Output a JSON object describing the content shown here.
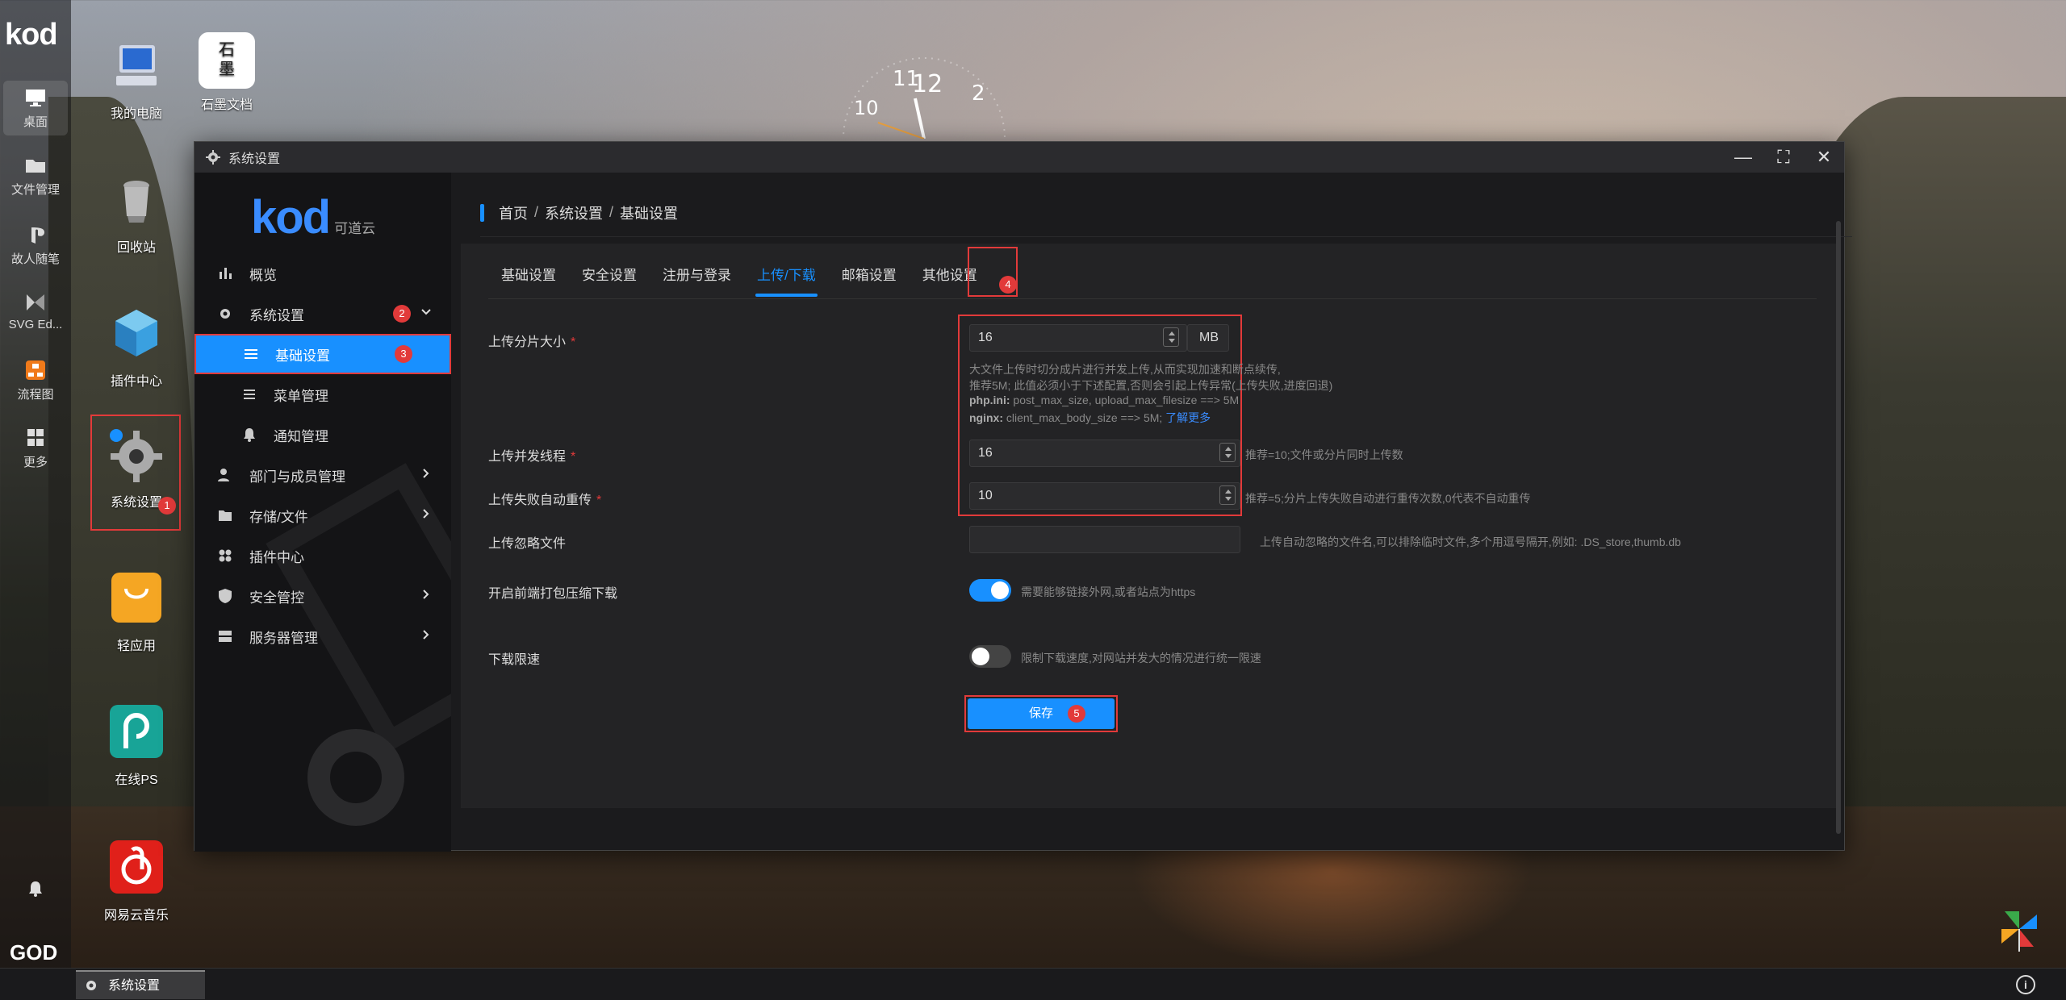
{
  "dock": {
    "logo": "kod",
    "items": [
      {
        "label": "桌面",
        "icon": "monitor-icon"
      },
      {
        "label": "文件管理",
        "icon": "folder-icon"
      },
      {
        "label": "故人随笔",
        "icon": "playstation-icon"
      },
      {
        "label": "SVG Ed...",
        "icon": "svg-editor-icon"
      },
      {
        "label": "流程图",
        "icon": "flowchart-icon"
      },
      {
        "label": "更多",
        "icon": "grid-icon"
      }
    ],
    "bottom_logo": "GOD"
  },
  "desktop": {
    "icons": [
      {
        "label": "我的电脑"
      },
      {
        "label": "石墨文档",
        "glyph": "石\n墨"
      },
      {
        "label": "回收站"
      },
      {
        "label": "插件中心"
      },
      {
        "label": "系统设置"
      },
      {
        "label": "轻应用"
      },
      {
        "label": "在线PS"
      },
      {
        "label": "网易云音乐"
      }
    ]
  },
  "badges": {
    "b1": "1",
    "b2": "2",
    "b3": "3",
    "b4": "4",
    "b5": "5"
  },
  "window": {
    "title": "系统设置",
    "controls": {
      "minimize": "—",
      "maximize": "⛶",
      "close": "✕"
    }
  },
  "sidebar": {
    "logo": "kod",
    "logo_sub": "可道云",
    "items": [
      {
        "label": "概览"
      },
      {
        "label": "系统设置"
      },
      {
        "label": "基础设置"
      },
      {
        "label": "菜单管理"
      },
      {
        "label": "通知管理"
      },
      {
        "label": "部门与成员管理"
      },
      {
        "label": "存储/文件"
      },
      {
        "label": "插件中心"
      },
      {
        "label": "安全管控"
      },
      {
        "label": "服务器管理"
      }
    ]
  },
  "breadcrumb": {
    "items": [
      "首页",
      "系统设置",
      "基础设置"
    ],
    "sep": "/"
  },
  "tabs": [
    "基础设置",
    "安全设置",
    "注册与登录",
    "上传/下载",
    "邮箱设置",
    "其他设置"
  ],
  "form": {
    "chunk_size": {
      "label": "上传分片大小",
      "value": "16",
      "unit": "MB",
      "hint1": "大文件上传时切分成片进行并发上传,从而实现加速和断点续传,",
      "hint2": "推荐5M; 此值必须小于下述配置,否则会引起上传异常(上传失败,进度回退)",
      "hint3_key": "php.ini:",
      "hint3_val": " post_max_size, upload_max_filesize ==> 5M",
      "hint4_key": "nginx:",
      "hint4_val": " client_max_body_size ==> 5M;",
      "hint4_link": "了解更多"
    },
    "threads": {
      "label": "上传并发线程",
      "value": "16",
      "hint": "推荐=10;文件或分片同时上传数"
    },
    "retry": {
      "label": "上传失败自动重传",
      "value": "10",
      "hint": "推荐=5;分片上传失败自动进行重传次数,0代表不自动重传"
    },
    "ignore": {
      "label": "上传忽略文件",
      "value": "",
      "hint": "上传自动忽略的文件名,可以排除临时文件,多个用逗号隔开,例如: .DS_store,thumb.db"
    },
    "zip_download": {
      "label": "开启前端打包压缩下载",
      "on": true,
      "hint": "需要能够链接外网,或者站点为https"
    },
    "speed_limit": {
      "label": "下载限速",
      "on": false,
      "hint": "限制下载速度,对网站并发大的情况进行统一限速"
    },
    "save_label": "保存"
  },
  "taskbar": {
    "item": "系统设置",
    "info": "i"
  },
  "colors": {
    "accent": "#1890ff",
    "highlight": "#e23a3a"
  }
}
